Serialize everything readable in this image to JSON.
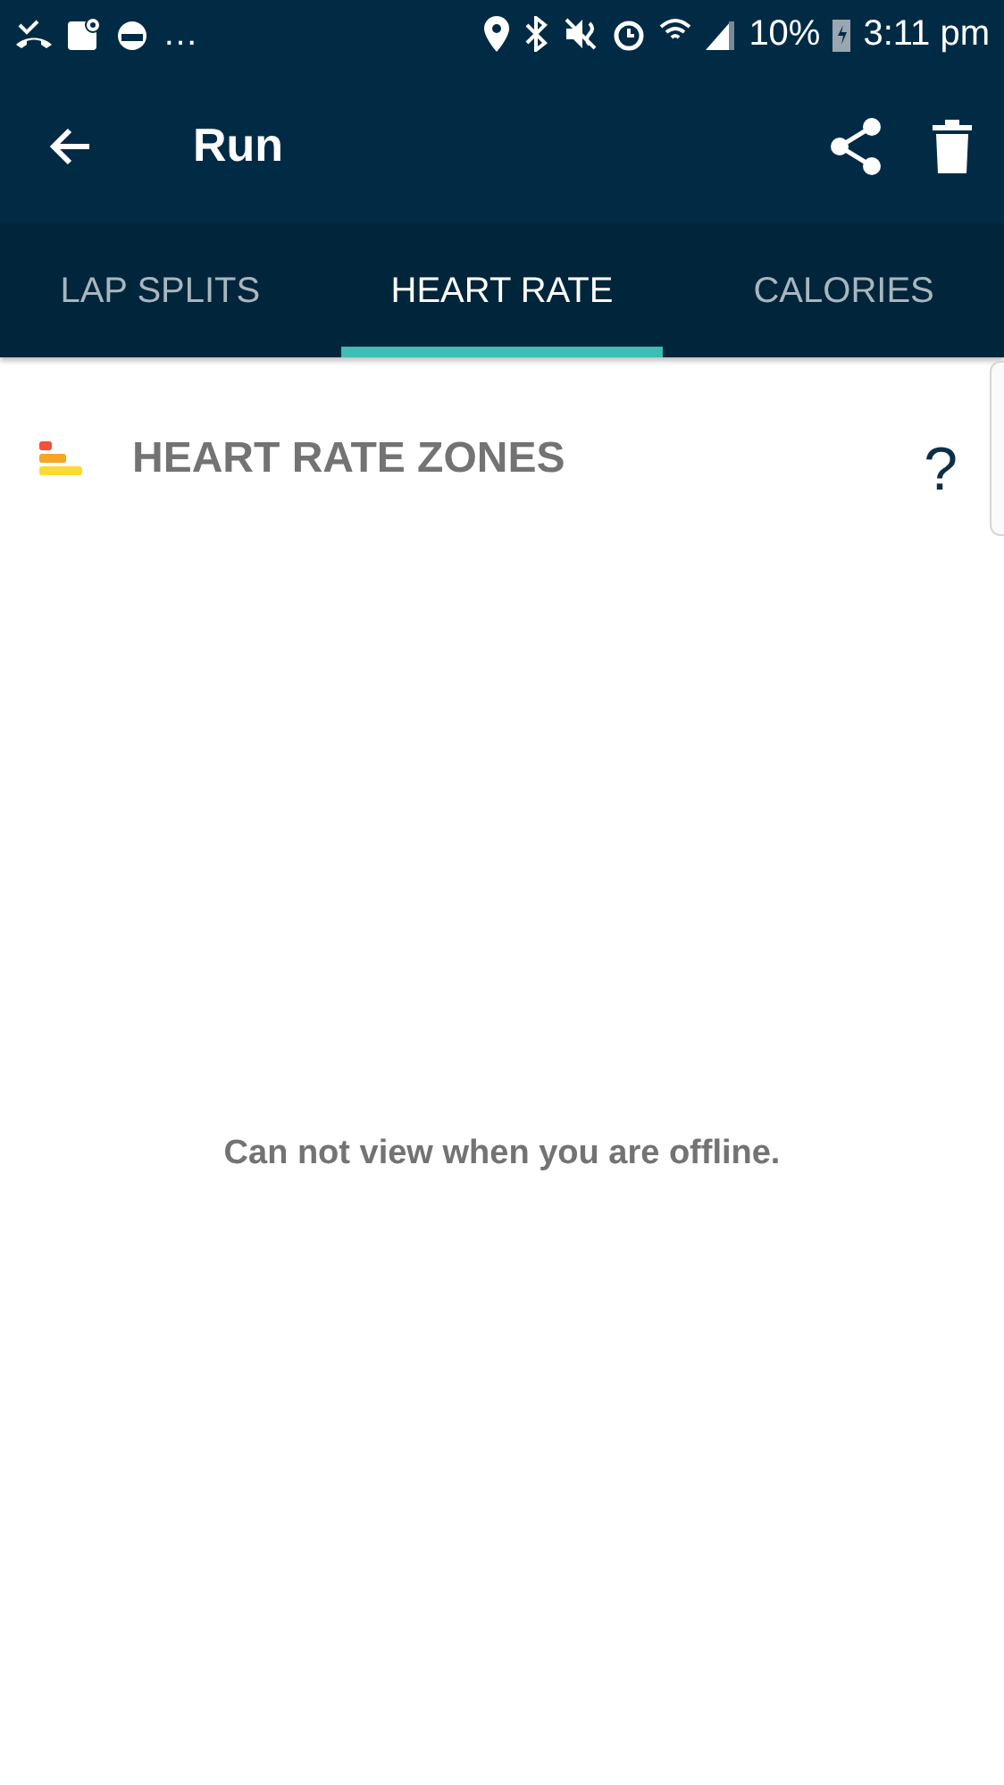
{
  "status_bar": {
    "more": "…",
    "battery": "10%",
    "time": "3:11 pm"
  },
  "app_bar": {
    "title": "Run"
  },
  "tabs": [
    {
      "label": "LAP SPLITS",
      "selected": false
    },
    {
      "label": "HEART RATE",
      "selected": true
    },
    {
      "label": "CALORIES",
      "selected": false
    }
  ],
  "section": {
    "title": "HEART RATE ZONES",
    "help": "?"
  },
  "message": "Can not view when you are offline."
}
